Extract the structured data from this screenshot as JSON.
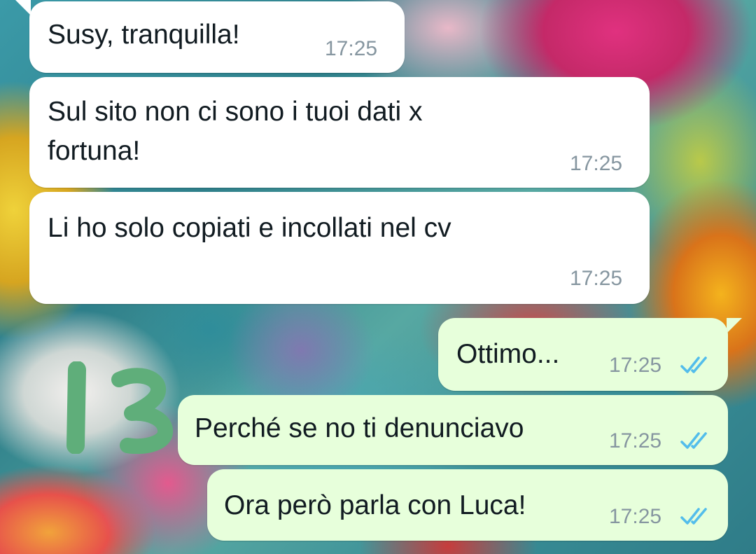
{
  "conversation": {
    "annotation": "13",
    "messages": [
      {
        "direction": "incoming",
        "text_lines": [
          "Susy, tranquilla!"
        ],
        "time": "17:25"
      },
      {
        "direction": "incoming",
        "text_lines": [
          "Sul sito non ci sono i tuoi dati x",
          "fortuna!"
        ],
        "time": "17:25"
      },
      {
        "direction": "incoming",
        "text_lines": [
          "Li ho solo copiati e incollati nel cv"
        ],
        "time": "17:25"
      },
      {
        "direction": "outgoing",
        "text_lines": [
          "Ottimo..."
        ],
        "time": "17:25",
        "status": "read",
        "status_icon": "double-check-icon"
      },
      {
        "direction": "outgoing",
        "text_lines": [
          "Perché se no ti denunciavo"
        ],
        "time": "17:25",
        "status": "read",
        "status_icon": "double-check-icon"
      },
      {
        "direction": "outgoing",
        "text_lines": [
          "Ora però parla con Luca!"
        ],
        "time": "17:25",
        "status": "read",
        "status_icon": "double-check-icon"
      }
    ]
  },
  "colors": {
    "incoming_bubble": "#ffffff",
    "outgoing_bubble": "#e7ffdb",
    "message_text": "#111b21",
    "timestamp": "#8696a0",
    "read_ticks": "#53bdeb",
    "annotation_ink": "#5fae7a"
  }
}
